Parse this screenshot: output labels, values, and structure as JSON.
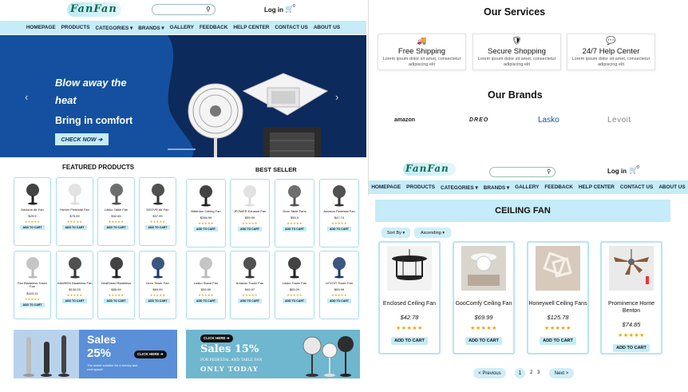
{
  "left": {
    "header": {
      "logo": "FanFan",
      "login": "Log in",
      "cart_count": "0"
    },
    "nav": [
      "HOMEPAGE",
      "PRODUCTS",
      "CATEGORIES ▾",
      "BRANDS ▾",
      "GALLERY",
      "FEEDBACK",
      "HELP CENTER",
      "CONTACT US",
      "ABOUT US"
    ],
    "hero": {
      "line1": "Blow away the",
      "line2": "heat",
      "line3": "Bring in comfort",
      "cta": "CHECK NOW ➔"
    },
    "featured": {
      "title": "FEATURED PRODUCTS",
      "add_label": "ADD TO CART",
      "items": [
        {
          "name": "Amazon Air Fan",
          "price": "$29.9"
        },
        {
          "name": "Hunter Pedestal Fan",
          "price": "$75.99"
        },
        {
          "name": "Lasko Table Fan",
          "price": "$32.65"
        },
        {
          "name": "DEGVR Air Fan",
          "price": "$37.99"
        },
        {
          "name": "Fan Bladeless Tower Fan",
          "price": "$423.21"
        },
        {
          "name": "HAWKEN Bladeless Fan",
          "price": "$130.03"
        },
        {
          "name": "HeatSmart Bladeless",
          "price": "$85.99"
        },
        {
          "name": "Dreo Tower Fan",
          "price": "$69.99"
        }
      ]
    },
    "bestseller": {
      "title": "BEST SELLER",
      "add_label": "ADD TO CART",
      "items": [
        {
          "name": "Bitbirdon Ceiling Fan",
          "price": "$266.99"
        },
        {
          "name": "JFOWER Exhaust Fan",
          "price": "$59.99"
        },
        {
          "name": "Dreo Table Fans",
          "price": "$53.9"
        },
        {
          "name": "Amazon Pedestal Fan",
          "price": "$47.74"
        },
        {
          "name": "Lasko Stand Fan",
          "price": "$39.99"
        },
        {
          "name": "Amazon Tower Fan",
          "price": "$49.97"
        },
        {
          "name": "Lasko Tower Fan",
          "price": "$65.29"
        },
        {
          "name": "LEVOIT Tower Fan",
          "price": "$59.99"
        }
      ]
    },
    "banner1": {
      "title": "Sales",
      "pct": "25%",
      "sub": "The sweet solution for a breezy and cool space!",
      "cta": "CLICK HERE ➔"
    },
    "banner2": {
      "cta": "CLICK HERE ➔",
      "title": "Sales 15%",
      "sub": "FOR PEDESTAL AND TABLE FAN",
      "today": "ONLY TODAY"
    }
  },
  "right": {
    "services": {
      "title": "Our Services",
      "items": [
        {
          "title": "Free Shipping",
          "desc": "Lorem ipsum dolor sit amet, consectetur adipiscing elit",
          "icon": "truck-icon"
        },
        {
          "title": "Secure Shopping",
          "desc": "Lorem ipsum dolor sit amet, consectetur adipiscing elit",
          "icon": "shield-icon"
        },
        {
          "title": "24/7 Help Center",
          "desc": "Lorem ipsum dolor sit amet, consectetur adipiscing elit",
          "icon": "chat-icon"
        }
      ]
    },
    "brands": {
      "title": "Our Brands",
      "items": [
        "amazon",
        "DREO",
        "Lasko",
        "Levoit"
      ]
    },
    "header": {
      "logo": "FanFan",
      "login": "Log in",
      "cart_count": "0"
    },
    "nav": [
      "HOMEPAGE",
      "PRODUCTS",
      "CATEGORIES ▾",
      "BRANDS ▾",
      "GALLERY",
      "FEEDBACK",
      "HELP CENTER",
      "CONTACT US",
      "ABOUT US"
    ],
    "category": {
      "title": "CEILING FAN",
      "sort": "Sort By ▾",
      "order": "Ascending ▾",
      "add_label": "ADD TO CART",
      "items": [
        {
          "name": "Enclosed Ceiling Fan",
          "price": "$42.78"
        },
        {
          "name": "GooComfy Ceiling Fan",
          "price": "$69.99"
        },
        {
          "name": "Honeywell Ceiling Fans",
          "price": "$125.78"
        },
        {
          "name": "Prominence Home Benton",
          "price": "$74.85"
        }
      ]
    },
    "pagination": {
      "prev": "< Previous",
      "pages": [
        "1",
        "2",
        "3"
      ],
      "next": "Next >"
    }
  },
  "stars": "★★★★★"
}
